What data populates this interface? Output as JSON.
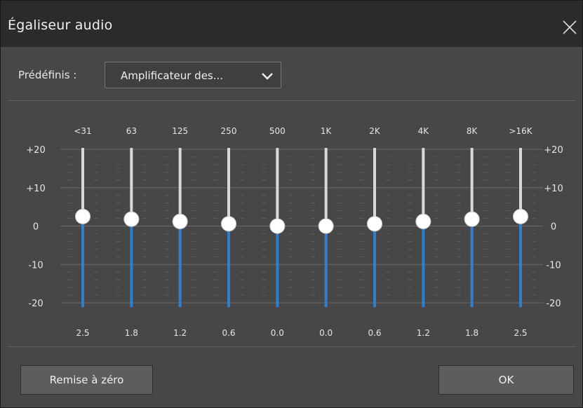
{
  "window": {
    "title": "Égaliseur audio"
  },
  "presets": {
    "label": "Prédéfinis :",
    "selected": "Amplificateur des..."
  },
  "equalizer": {
    "scale_labels": [
      "+20",
      "+10",
      "0",
      "-10",
      "-20"
    ],
    "bands": [
      {
        "freq": "<31",
        "value": 2.5,
        "value_label": "2.5"
      },
      {
        "freq": "63",
        "value": 1.8,
        "value_label": "1.8"
      },
      {
        "freq": "125",
        "value": 1.2,
        "value_label": "1.2"
      },
      {
        "freq": "250",
        "value": 0.6,
        "value_label": "0.6"
      },
      {
        "freq": "500",
        "value": 0.0,
        "value_label": "0.0"
      },
      {
        "freq": "1K",
        "value": 0.0,
        "value_label": "0.0"
      },
      {
        "freq": "2K",
        "value": 0.6,
        "value_label": "0.6"
      },
      {
        "freq": "4K",
        "value": 1.2,
        "value_label": "1.2"
      },
      {
        "freq": "8K",
        "value": 1.8,
        "value_label": "1.8"
      },
      {
        "freq": ">16K",
        "value": 2.5,
        "value_label": "2.5"
      }
    ],
    "range": [
      -20,
      20
    ],
    "colors": {
      "fill": "#2f7fd0",
      "track": "#d8d8d8",
      "knob": "#ffffff"
    }
  },
  "buttons": {
    "reset": "Remise à zéro",
    "ok": "OK"
  }
}
